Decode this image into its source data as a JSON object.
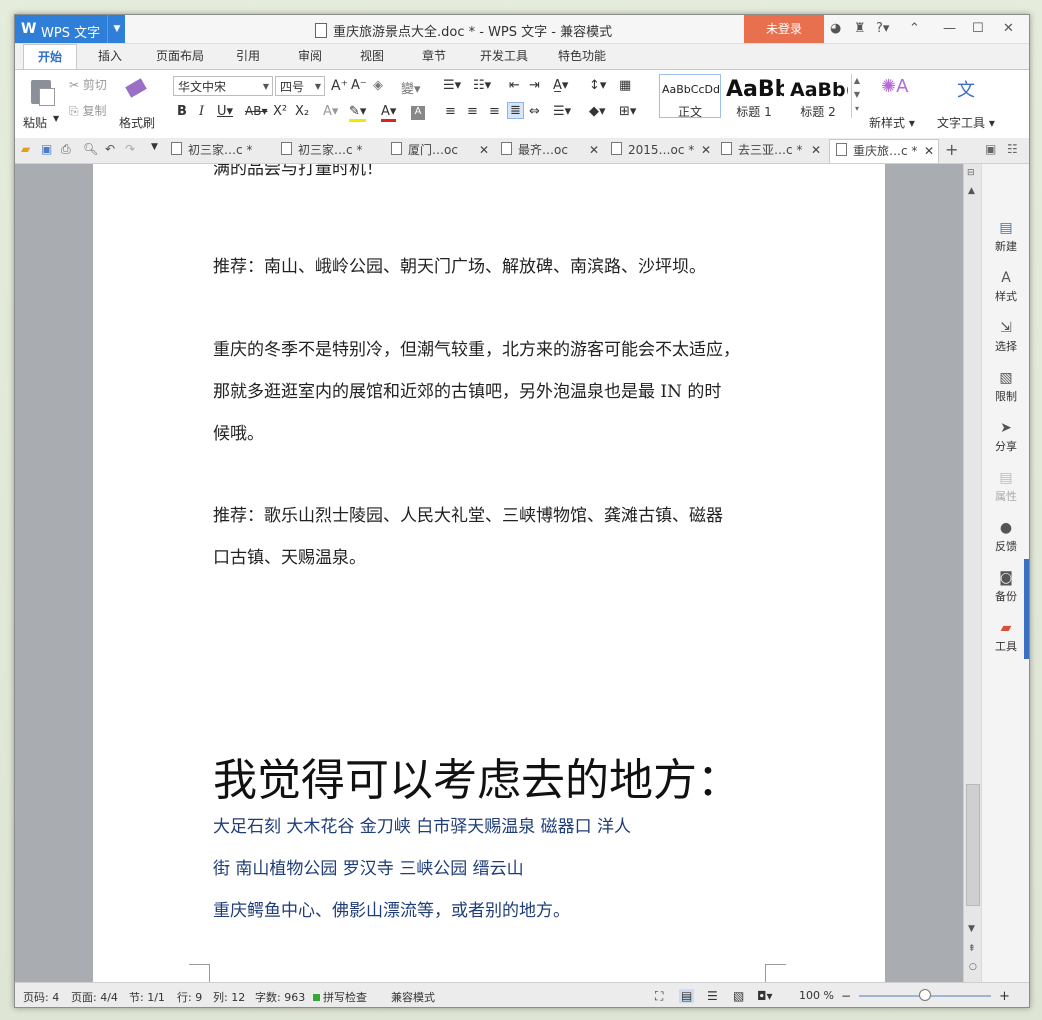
{
  "app": {
    "name": "WPS 文字",
    "logo": "W",
    "doc_title": "重庆旅游景点大全.doc * - WPS 文字 - 兼容模式",
    "login": "未登录"
  },
  "menus": [
    "开始",
    "插入",
    "页面布局",
    "引用",
    "审阅",
    "视图",
    "章节",
    "开发工具",
    "特色功能"
  ],
  "ribbon": {
    "paste": "粘贴",
    "cut": "剪切",
    "copy": "复制",
    "format_painter": "格式刷",
    "font_name": "华文中宋",
    "font_size": "四号",
    "styles": [
      {
        "preview": "AaBbCcDd",
        "label": "正文"
      },
      {
        "preview": "AaBb",
        "label": "标题 1"
      },
      {
        "preview": "AaBb(",
        "label": "标题 2"
      }
    ],
    "new_style": "新样式",
    "text_tools": "文字工具"
  },
  "file_tabs": [
    "初三家…c *",
    "初三家…c *",
    "厦门…oc",
    "最齐…oc",
    "2015…oc *",
    "去三亚…c *",
    "重庆旅…c *"
  ],
  "document": {
    "top_cut": "满的品尝与打量时机！",
    "p1": "推荐：南山、峨岭公园、朝天门广场、解放碑、南滨路、沙坪坝。",
    "p2_l1": "重庆的冬季不是特别冷，但潮气较重，北方来的游客可能会不太适应，",
    "p2_l2": "那就多逛逛室内的展馆和近郊的古镇吧，另外泡温泉也是最 IN 的时",
    "p2_l3": "候哦。",
    "p3_l1": "推荐：歌乐山烈士陵园、人民大礼堂、三峡博物馆、龚滩古镇、磁器",
    "p3_l2": "口古镇、天赐温泉。",
    "heading": "我觉得可以考虑去的地方：",
    "b1": "大足石刻    大木花谷   金刀峡    白市驿天赐温泉    磁器口   洋人",
    "b2": "街    南山植物公园     罗汉寺     三峡公园    缙云山",
    "b3": "重庆鳄鱼中心、佛影山漂流等，或者别的地方。"
  },
  "side_panel": [
    "新建",
    "样式",
    "选择",
    "限制",
    "分享",
    "属性",
    "反馈",
    "备份",
    "工具"
  ],
  "status": {
    "page_code": "页码: 4",
    "pages": "页面: 4/4",
    "section": "节: 1/1",
    "row": "行: 9",
    "col": "列: 12",
    "words": "字数: 963",
    "spell": "拼写检查",
    "compat": "兼容模式",
    "zoom": "100 %"
  },
  "colors": {
    "brand": "#2f7fd8",
    "login": "#e8704f",
    "body_text": "#222222",
    "list_blue": "#1f3d79"
  }
}
